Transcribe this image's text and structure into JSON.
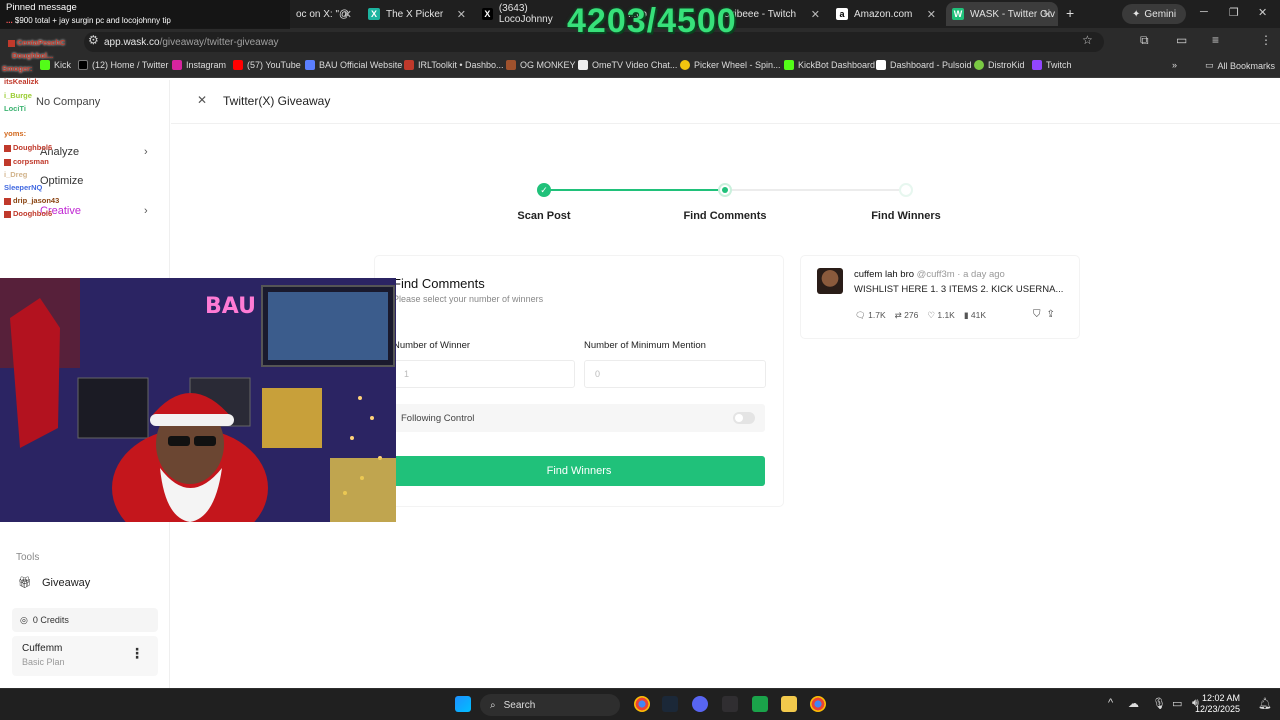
{
  "browser": {
    "tabs": [
      {
        "label": "oc on X: \"@",
        "active": false
      },
      {
        "label": "The X Picker",
        "active": false
      },
      {
        "label": "(3643) LocoJohnny",
        "active": false
      },
      {
        "label": "...co",
        "active": false
      },
      {
        "label": "evibeee - Twitch",
        "active": false
      },
      {
        "label": "Amazon.com",
        "active": false
      },
      {
        "label": "WASK - Twitter Giv",
        "active": true
      }
    ],
    "gemini_label": "Gemini",
    "url_host": "app.wask.co",
    "url_path": "/giveaway/twitter-giveaway",
    "bookmarks": [
      "Kick",
      "(12) Home / Twitter",
      "Instagram",
      "(57) YouTube",
      "BAU Official Website",
      "IRLToolkit • Dashbo...",
      "OG MONKEY",
      "OmeTV Video Chat...",
      "Picker Wheel - Spin...",
      "KickBot Dashboard",
      "Dashboard - Pulsoid",
      "DistroKid",
      "Twitch"
    ],
    "all_bookmarks_label": "All Bookmarks"
  },
  "sidebar": {
    "company": "No Company",
    "nav": [
      {
        "label": "Analyze",
        "chevron": true
      },
      {
        "label": "Optimize",
        "chevron": false
      },
      {
        "label": "Creative",
        "chevron": true
      }
    ],
    "tools_label": "Tools",
    "giveaway_label": "Giveaway",
    "credits": "0 Credits",
    "account_name": "Cuffemm",
    "account_plan": "Basic Plan"
  },
  "header": {
    "title": "Twitter(X) Giveaway"
  },
  "stepper": {
    "steps": [
      {
        "label": "Scan Post",
        "state": "done"
      },
      {
        "label": "Find Comments",
        "state": "current"
      },
      {
        "label": "Find Winners",
        "state": "pending"
      }
    ]
  },
  "form": {
    "title": "Find Comments",
    "subtitle": "Please select your number of winners",
    "winner_label": "Number of Winner",
    "winner_placeholder": "1",
    "mention_label": "Number of Minimum Mention",
    "mention_placeholder": "0",
    "following_label": "Following Control",
    "following_on": false,
    "button_label": "Find Winners"
  },
  "tweet": {
    "name": "cuffem lah bro",
    "handle": "@cuff3m",
    "time": "a day ago",
    "text": "WISHLIST HERE 1. 3 ITEMS 2. KICK USERNA...",
    "replies": "1.7K",
    "retweets": "276",
    "likes": "1.1K",
    "views": "41K"
  },
  "overlay": {
    "counter": "4203/4500",
    "pinned_head": "Pinned message",
    "pinned_user": "...",
    "pinned_text": "$900 total + jay surgin pc and locojohnny tip",
    "chat_names": [
      "CentaPeachC",
      "Doughbol...",
      "Smoger:",
      "itsKealizk",
      "i_Burge",
      "LociTi",
      "yoms:",
      "Doughbol6",
      "corpsman",
      "i_Dreg",
      "SleeperNQ",
      "drip_jason43",
      "Dooghbol6"
    ]
  },
  "taskbar": {
    "search_label": "Search",
    "time": "12:02 AM",
    "date": "12/23/2025"
  },
  "colors": {
    "accent": "#20c17a",
    "counter": "#37e07a",
    "chrome_bg": "#1f1f1f"
  }
}
